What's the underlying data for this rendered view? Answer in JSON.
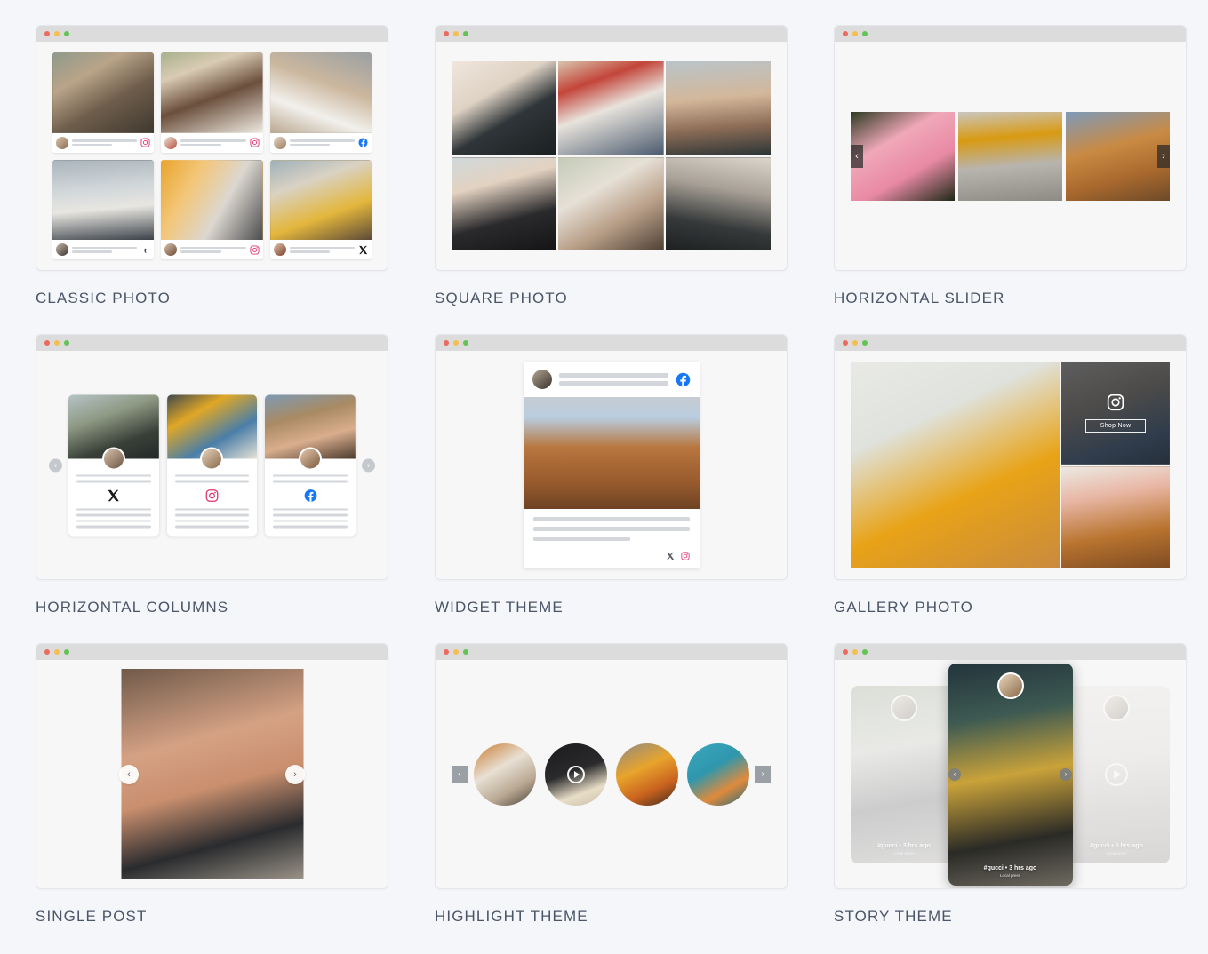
{
  "page": {
    "background_color": "#f4f6f9"
  },
  "browser_chrome": {
    "dots": [
      "red",
      "yellow",
      "green"
    ],
    "dot_colors": [
      "#ec6a5e",
      "#f4bf4f",
      "#61c454"
    ]
  },
  "themes": [
    {
      "id": "classic-photo",
      "label": "CLASSIC PHOTO",
      "layout": "grid-3x2-post-cards",
      "posts": [
        {
          "platform": "instagram",
          "subject": "woman with headphones and glasses"
        },
        {
          "platform": "instagram",
          "subject": "man in white tank top"
        },
        {
          "platform": "facebook",
          "subject": "person holding white headphones"
        },
        {
          "platform": "tumblr",
          "subject": "bearded man with headphones"
        },
        {
          "platform": "instagram",
          "subject": "headphones on laptop desk"
        },
        {
          "platform": "twitter-x",
          "subject": "woman in yellow jacket with coffee"
        }
      ]
    },
    {
      "id": "square-photo",
      "label": "SQUARE PHOTO",
      "layout": "grid-3x2-tight",
      "tiles": [
        "vintage film camera held in hand",
        "woman holding instant camera with flag",
        "woman shooting with dslr camera",
        "woman in black hat with compact camera",
        "woman in white tee with camera on street",
        "man operating cinema camera rig"
      ]
    },
    {
      "id": "horizontal-slider",
      "label": "HORIZONTAL SLIDER",
      "layout": "carousel-3-across",
      "prev_label": "‹",
      "next_label": "›",
      "slides": [
        "pink sneakers on grass",
        "yellow trousers on skateboard",
        "tan leather work boots"
      ]
    },
    {
      "id": "horizontal-columns",
      "label": "HORIZONTAL COLUMNS",
      "layout": "carousel-3-column-cards",
      "prev_label": "‹",
      "next_label": "›",
      "columns": [
        {
          "platform": "twitter-x",
          "subject": "couple by the lake in sunglasses"
        },
        {
          "platform": "instagram",
          "subject": "mother and baby laughing outdoors"
        },
        {
          "platform": "facebook",
          "subject": "smiling couple in cap and sunglasses"
        }
      ]
    },
    {
      "id": "widget-theme",
      "label": "WIDGET THEME",
      "layout": "single-widget-card",
      "header_platform": "facebook",
      "photo": "ornate historic brick building on corner",
      "footer_platforms": [
        "twitter-x",
        "instagram"
      ]
    },
    {
      "id": "gallery-photo",
      "label": "GALLERY PHOTO",
      "layout": "mosaic-1-large-2-small",
      "main_photo": "woman holding a pineapple in front of her face",
      "overlay": {
        "icon": "instagram",
        "button_label": "Shop Now",
        "photo": "denim jeans flat lay"
      },
      "bottom_photo": "tulips in a vase on wooden board"
    },
    {
      "id": "single-post",
      "label": "SINGLE POST",
      "layout": "single-large-photo",
      "prev_label": "‹",
      "next_label": "›",
      "photo": "smiling woman with curly hair and round glasses"
    },
    {
      "id": "highlight-theme",
      "label": "HIGHLIGHT THEME",
      "layout": "circular-story-highlights",
      "prev_label": "‹",
      "next_label": "›",
      "highlights": [
        {
          "subject": "hand sprinkling over a bowl of food",
          "has_video": false
        },
        {
          "subject": "hands lifting noodles with chopsticks",
          "has_video": true
        },
        {
          "subject": "orange curry bowl in dark pan",
          "has_video": false
        },
        {
          "subject": "teal bowl of curry with spoon",
          "has_video": false
        }
      ]
    },
    {
      "id": "story-theme",
      "label": "STORY THEME",
      "layout": "story-carousel",
      "prev_label": "‹",
      "next_label": "›",
      "stories": [
        {
          "active": false,
          "subject": "woman walking in black tracksuit",
          "caption_title": "#gucci • 3 hrs ago",
          "caption_sub": "Local press",
          "has_video": false
        },
        {
          "active": true,
          "subject": "woman in hat and floral skirt on street",
          "caption_title": "#gucci • 3 hrs ago",
          "caption_sub": "Local press",
          "has_video": false
        },
        {
          "active": false,
          "subject": "boston terrier dog in pink bandana",
          "caption_title": "#gucci • 3 hrs ago",
          "caption_sub": "Local press",
          "has_video": true
        }
      ]
    }
  ],
  "platform_colors": {
    "instagram": "#e1306c",
    "facebook": "#1877f2",
    "twitter-x": "#1a1a1a",
    "tumblr": "#24354a"
  }
}
